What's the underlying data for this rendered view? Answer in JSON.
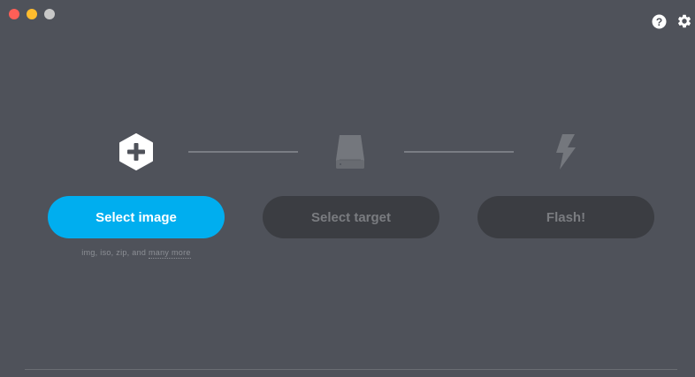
{
  "window": {
    "controls": [
      "close",
      "minimize",
      "maximize"
    ]
  },
  "toolbar": {
    "help_icon": "help-icon",
    "settings_icon": "gear-icon"
  },
  "steps": {
    "image": {
      "icon": "plus-hexagon-icon",
      "button_label": "Select image"
    },
    "target": {
      "icon": "drive-icon",
      "button_label": "Select target"
    },
    "flash": {
      "icon": "lightning-icon",
      "button_label": "Flash!"
    }
  },
  "formats": {
    "prefix": "img, iso, zip, and ",
    "more_link": "many more"
  },
  "colors": {
    "background": "#4f525a",
    "accent": "#00aeef",
    "disabled_button": "#3b3d42",
    "disabled_text": "#7a7c80"
  }
}
